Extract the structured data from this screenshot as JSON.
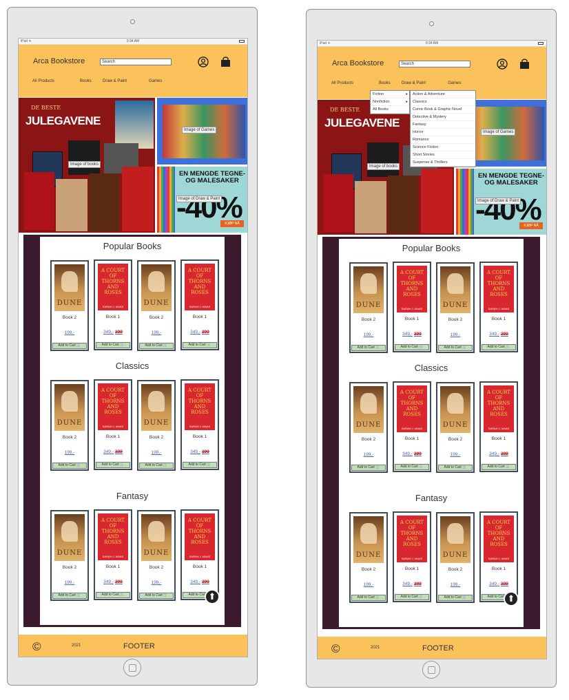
{
  "status": {
    "carrier": "iPad ✈",
    "time": "9:34 AM"
  },
  "brand": "Arca Bookstore",
  "search": {
    "placeholder": "Search"
  },
  "nav": [
    "All Products",
    "Books",
    "Draw & Paint",
    "Games"
  ],
  "banners": {
    "books": {
      "label": "Image of books",
      "headline_small": "DE BESTE",
      "headline": "JULEGAVENE"
    },
    "games": {
      "label": "Image of Games"
    },
    "draw": {
      "label": "Image of Draw & Paint",
      "headline": "EN MENGDE TEGNE- OG MALESAKER",
      "big": "-40%",
      "cta": "KJØP NÅ"
    }
  },
  "sections": [
    {
      "title": "Popular Books"
    },
    {
      "title": "Classics"
    },
    {
      "title": "Fantasy"
    }
  ],
  "books": [
    {
      "name": "Book 2",
      "cover": "dune",
      "cover_title": "DUNE",
      "price": "199,-",
      "add": "Add to Cart"
    },
    {
      "name": "Book 1",
      "cover": "acotar",
      "cover_title": "A COURT OF THORNS AND ROSES",
      "author": "SARAH J. MAAS",
      "price": "349,-",
      "old_price": "399",
      "add": "Add to Cart"
    },
    {
      "name": "Book 2",
      "cover": "dune",
      "cover_title": "DUNE",
      "price": "199,-",
      "add": "Add to Cart"
    },
    {
      "name": "Book 1",
      "cover": "acotar",
      "cover_title": "A COURT OF THORNS AND ROSES",
      "author": "SARAH J. MAAS",
      "price": "349,-",
      "old_price": "399",
      "add": "Add to Cart"
    }
  ],
  "footer": {
    "copyright": "©",
    "year": "2021",
    "text": "FOOTER"
  },
  "dropdown": {
    "main": [
      "Fiction",
      "Nonfiction",
      "All Books"
    ],
    "fiction": [
      "Action & Adventure",
      "Classics",
      "Comic Book & Graphic Novel",
      "Detective & Mystery",
      "Fantasy",
      "Horror",
      "Romance",
      "Science Fiction",
      "Short Stories",
      "Suspense & Thrillers"
    ]
  },
  "colors": {
    "header": "#fbc15a",
    "content_bg": "#3a1a2c",
    "add_to_cart": "#bfdfb9"
  }
}
